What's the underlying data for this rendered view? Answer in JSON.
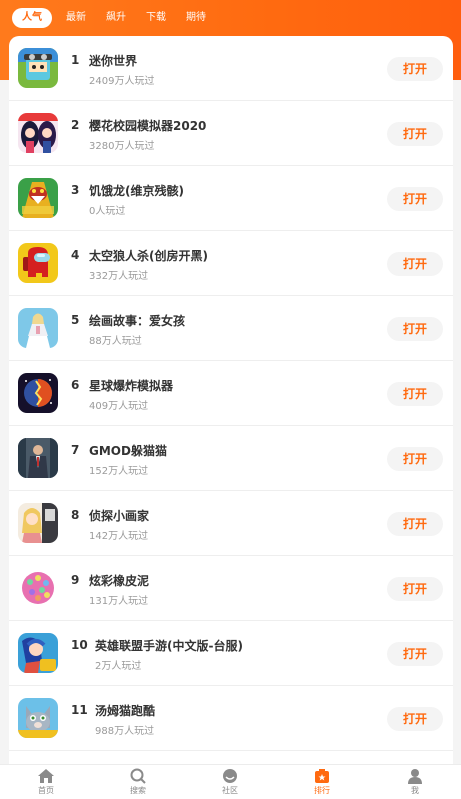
{
  "tabs": [
    {
      "label": "人气",
      "active": true
    },
    {
      "label": "最新",
      "active": false
    },
    {
      "label": "飙升",
      "active": false
    },
    {
      "label": "下载",
      "active": false
    },
    {
      "label": "期待",
      "active": false
    }
  ],
  "rankings": [
    {
      "rank": "1",
      "name": "迷你世界",
      "plays": "2409万人玩过",
      "button": "打开",
      "icon": "mini-world-icon",
      "color": "#8fc14a"
    },
    {
      "rank": "2",
      "name": "樱花校园模拟器2020",
      "plays": "3280万人玩过",
      "button": "打开",
      "icon": "sakura-school-icon",
      "color": "#2a2a5a"
    },
    {
      "rank": "3",
      "name": "饥饿龙(维京残骸)",
      "plays": "0人玩过",
      "button": "打开",
      "icon": "hungry-dragon-icon",
      "color": "#e3a21a"
    },
    {
      "rank": "4",
      "name": "太空狼人杀(创房开黑)",
      "plays": "332万人玩过",
      "button": "打开",
      "icon": "among-us-icon",
      "color": "#f2c81a"
    },
    {
      "rank": "5",
      "name": "绘画故事：爱女孩",
      "plays": "88万人玩过",
      "button": "打开",
      "icon": "drawing-story-icon",
      "color": "#7ec8e8"
    },
    {
      "rank": "6",
      "name": "星球爆炸模拟器",
      "plays": "409万人玩过",
      "button": "打开",
      "icon": "planet-explosion-icon",
      "color": "#2a1a3a"
    },
    {
      "rank": "7",
      "name": "GMOD躲猫猫",
      "plays": "152万人玩过",
      "button": "打开",
      "icon": "gmod-icon",
      "color": "#5a6a7a"
    },
    {
      "rank": "8",
      "name": "侦探小画家",
      "plays": "142万人玩过",
      "button": "打开",
      "icon": "detective-painter-icon",
      "color": "#e8c070"
    },
    {
      "rank": "9",
      "name": "炫彩橡皮泥",
      "plays": "131万人玩过",
      "button": "打开",
      "icon": "slime-icon",
      "color": "#e070a8"
    },
    {
      "rank": "10",
      "name": "英雄联盟手游(中文版-台服)",
      "plays": "2万人玩过",
      "button": "打开",
      "icon": "lol-mobile-icon",
      "color": "#3aa0d8"
    },
    {
      "rank": "11",
      "name": "汤姆猫跑酷",
      "plays": "988万人玩过",
      "button": "打开",
      "icon": "talking-tom-icon",
      "color": "#f0c020"
    }
  ],
  "nav": [
    {
      "label": "首页",
      "icon": "home-icon",
      "active": false
    },
    {
      "label": "搜索",
      "icon": "search-icon",
      "active": false
    },
    {
      "label": "社区",
      "icon": "community-icon",
      "active": false
    },
    {
      "label": "排行",
      "icon": "ranking-icon",
      "active": true
    },
    {
      "label": "我",
      "icon": "user-icon",
      "active": false
    }
  ],
  "colors": {
    "accent": "#ff6a10",
    "background": "#f4f4f4"
  }
}
